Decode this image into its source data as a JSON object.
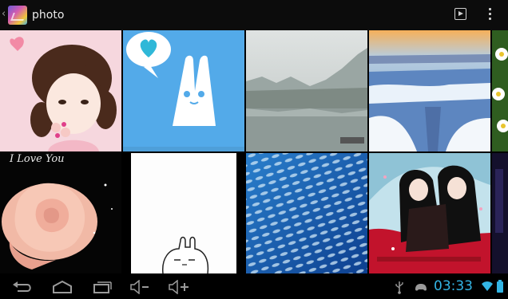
{
  "action_bar": {
    "title": "photo"
  },
  "gallery": {
    "tiles": [
      {
        "name": "photo-girl-pink"
      },
      {
        "name": "photo-bunny-heart"
      },
      {
        "name": "photo-misty-river"
      },
      {
        "name": "photo-icy-water"
      },
      {
        "name": "photo-flowers-edge"
      },
      {
        "name": "photo-i-love-you-rose",
        "caption": "I Love You"
      },
      {
        "name": "photo-bunny-doodle"
      },
      {
        "name": "photo-fish-school"
      },
      {
        "name": "photo-anime-couple"
      },
      {
        "name": "photo-dark-edge"
      }
    ]
  },
  "status_bar": {
    "time": "03:33"
  },
  "colors": {
    "accent": "#33b5e5",
    "bar": "#000000"
  }
}
